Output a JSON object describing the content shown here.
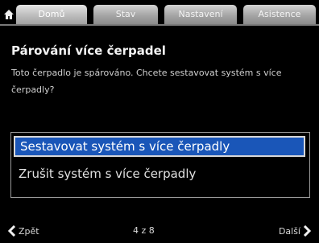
{
  "tabs": [
    {
      "label": "Domů",
      "active": true
    },
    {
      "label": "Stav",
      "active": false
    },
    {
      "label": "Nastavení",
      "active": false
    },
    {
      "label": "Asistence",
      "active": false
    }
  ],
  "icons": {
    "home": "home-icon",
    "back": "chevron-left-icon",
    "next": "chevron-right-icon"
  },
  "dialog": {
    "title": "Párování více čerpadel",
    "description": "Toto čerpadlo je spárováno. Chcete sestavovat systém s více čerpadly?"
  },
  "options": [
    {
      "label": "Sestavovat systém s více čerpadly",
      "selected": true
    },
    {
      "label": "Zrušit systém s více čerpadly",
      "selected": false
    }
  ],
  "footer": {
    "back_label": "Zpět",
    "page_indicator": "4 z 8",
    "next_label": "Další"
  },
  "colors": {
    "selection": "#1a56b8",
    "background": "#000000",
    "tab": "#a5a5a5"
  }
}
